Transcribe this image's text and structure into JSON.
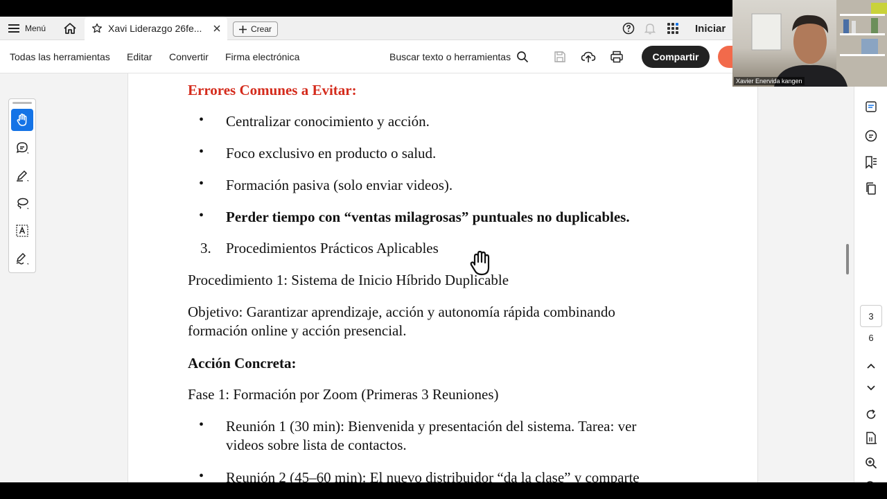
{
  "tabbar": {
    "menu_label": "Menú",
    "doc_tab_title": "Xavi Liderazgo 26fe...",
    "new_label": "Crear",
    "signin_label": "Iniciar"
  },
  "toolbar": {
    "all_tools": "Todas las herramientas",
    "edit": "Editar",
    "convert": "Convertir",
    "esign": "Firma electrónica",
    "search_tools": "Buscar texto o herramientas",
    "share": "Compartir"
  },
  "document": {
    "heading_errors": "Errores Comunes a Evitar:",
    "bullets_errors": [
      "Centralizar conocimiento y acción.",
      "Foco exclusivo en producto o salud.",
      "Formación pasiva (solo enviar videos).",
      "Perder tiempo con “ventas milagrosas” puntuales no duplicables."
    ],
    "numbered_item_num": "3.",
    "numbered_item_text": "Procedimientos Prácticos Aplicables",
    "procedure1": "Procedimiento 1: Sistema de Inicio Híbrido Duplicable",
    "objective_line1": "Objetivo: Garantizar aprendizaje, acción y autonomía rápida combinando",
    "objective_line2": "formación online y acción presencial.",
    "concrete_action": "Acción Concreta:",
    "phase1": "Fase 1: Formación por Zoom (Primeras 3 Reuniones)",
    "meeting1_line1": "Reunión 1 (30 min): Bienvenida y presentación del sistema. Tarea: ver",
    "meeting1_line2": "videos sobre lista de contactos.",
    "meeting2_line1": "Reunión 2 (45–60 min): El nuevo distribuidor “da la clase” y comparte"
  },
  "right_panel": {
    "current_page": "3",
    "total_pages": "6"
  },
  "webcam": {
    "participant_name": "Xavier Enervida kangen"
  },
  "colors": {
    "accent": "#1473e6",
    "heading_red": "#d42b1c",
    "share_bg": "#222222",
    "orange": "#f26a4b"
  }
}
